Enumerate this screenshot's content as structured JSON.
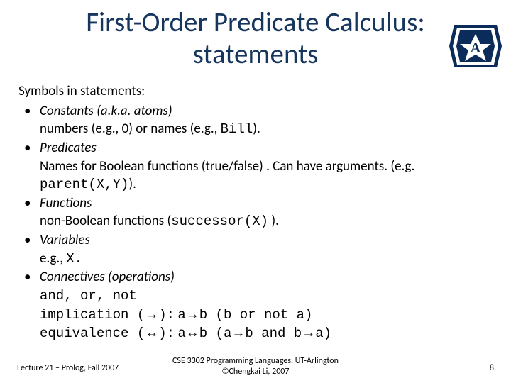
{
  "title_l1": "First-Order Predicate Calculus:",
  "title_l2": "statements",
  "lead": "Symbols in statements:",
  "items": [
    {
      "term": "Constants (a.k.a. atoms)",
      "desc_pre": "numbers (e.g., 0) or names (e.g., ",
      "desc_mono": "Bill",
      "desc_post": ")."
    },
    {
      "term": "Predicates",
      "desc_pre": "Names for Boolean functions (true/false) . Can have arguments. (e.g. ",
      "desc_mono": "parent(X,Y)",
      "desc_post": ")."
    },
    {
      "term": "Functions",
      "desc_pre": "non-Boolean functions (",
      "desc_mono": "successor(X)",
      "desc_post": " )."
    },
    {
      "term": "Variables",
      "desc_pre": "e.g., ",
      "desc_mono": "X.",
      "desc_post": ""
    }
  ],
  "conn_term": "Connectives (operations)",
  "conn_l1": "and, or, not",
  "conn_imp_label": "implication (",
  "conn_imp_sym": "→",
  "conn_imp_mid": "):",
  "conn_imp_expr_a": "a",
  "conn_imp_expr_b": "b (b or not a)",
  "conn_eq_label": "equivalence (",
  "conn_eq_sym": "↔",
  "conn_eq_mid": "):",
  "conn_eq_a": "a",
  "conn_eq_b": "b (a",
  "conn_eq_c": "b and b",
  "conn_eq_d": "a)",
  "footer_left": "Lecture 21 – Prolog, Fall 2007",
  "footer_center_l1": "CSE 3302 Programming Languages, UT-Arlington",
  "footer_center_l2": "©Chengkai Li, 2007",
  "footer_right": "8"
}
